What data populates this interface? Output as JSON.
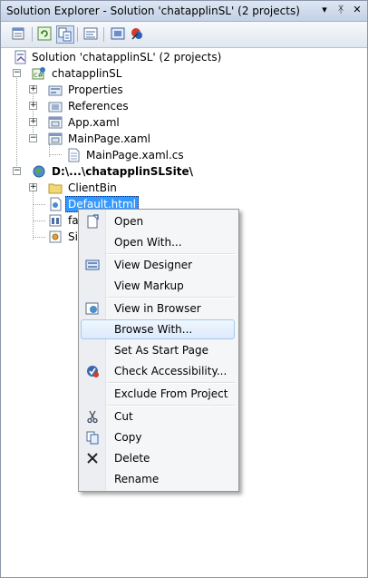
{
  "window": {
    "title": "Solution Explorer - Solution 'chatapplinSL' (2 projects)",
    "buttons": [
      "▾",
      "ᛡ",
      "✕"
    ]
  },
  "tree": {
    "solution": "Solution 'chatapplinSL' (2 projects)",
    "project1": "chatapplinSL",
    "properties": "Properties",
    "references": "References",
    "app_xaml": "App.xaml",
    "mainpage_xaml": "MainPage.xaml",
    "mainpage_cs": "MainPage.xaml.cs",
    "project2": "D:\\...\\chatapplinSLSite\\",
    "clientbin": "ClientBin",
    "default_html": "Default.html",
    "fa_partial": "fa",
    "si_partial": "Si"
  },
  "context_menu": {
    "items": [
      "Open",
      "Open With...",
      "View Designer",
      "View Markup",
      "View in Browser",
      "Browse With...",
      "Set As Start Page",
      "Check Accessibility...",
      "Exclude From Project",
      "Cut",
      "Copy",
      "Delete",
      "Rename"
    ],
    "highlighted": "Browse With..."
  },
  "colors": {
    "selection": "#3399ff",
    "menu_hover_border": "#a8c8eb",
    "title_bar": "#c3d1e6"
  }
}
